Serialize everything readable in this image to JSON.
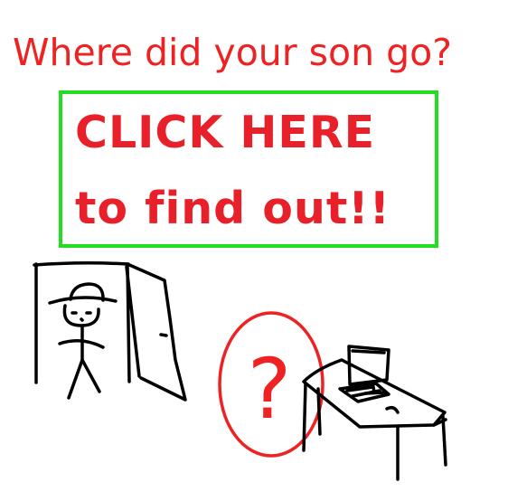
{
  "headline": "Where did your son go?",
  "cta": {
    "line1": "CLICK HERE",
    "line2": "to find out!!"
  },
  "mystery_symbol": "?",
  "colors": {
    "headline": "#ee2222",
    "cta_text": "#e8202a",
    "cta_border": "#22dd22",
    "drawing": "#000000",
    "mystery": "#ee2222"
  },
  "icons": {
    "figure": "stick-figure-icon",
    "door": "door-icon",
    "desk": "computer-desk-icon",
    "mystery": "question-mark-icon"
  }
}
